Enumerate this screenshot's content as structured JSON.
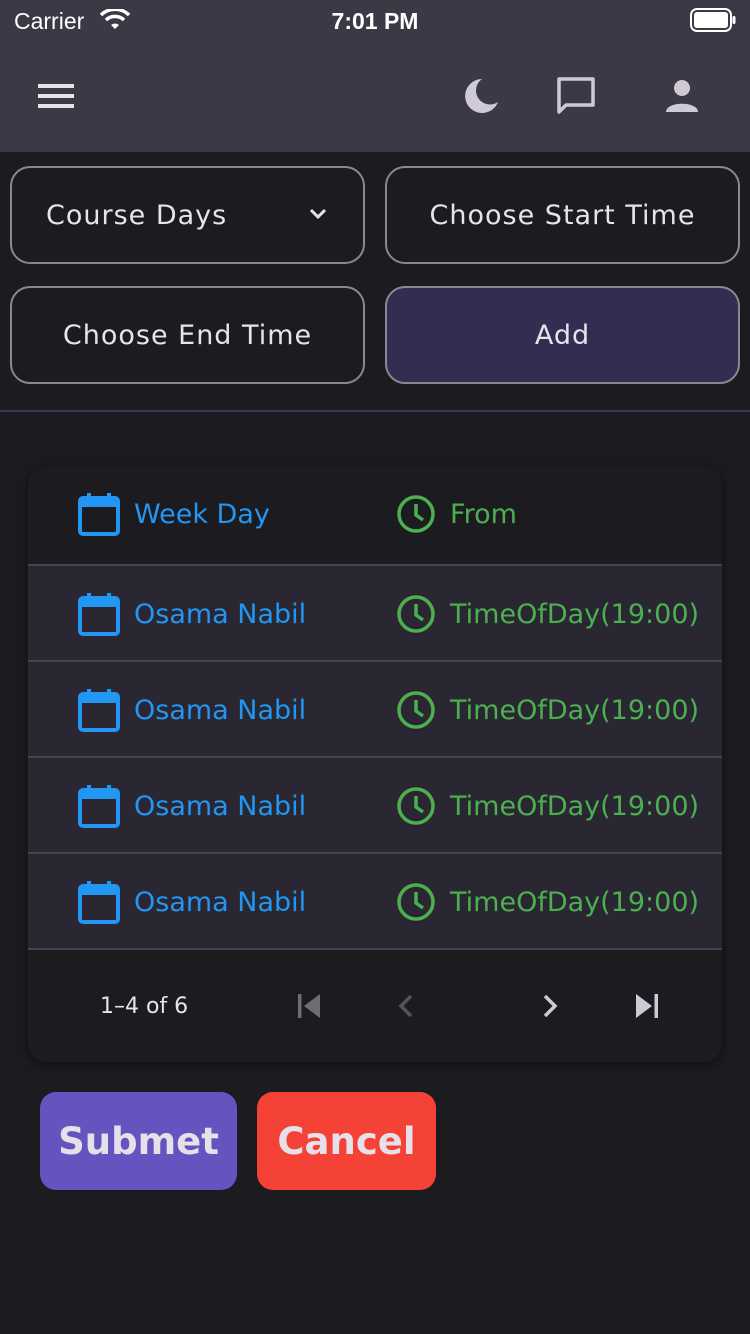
{
  "status_bar": {
    "carrier": "Carrier",
    "time": "7:01 PM"
  },
  "app_bar": {
    "icons": [
      "menu-icon",
      "moon-icon",
      "chat-icon",
      "person-icon"
    ]
  },
  "form": {
    "course_days_label": "Course Days",
    "start_time_label": "Choose Start Time",
    "end_time_label": "Choose End Time",
    "add_label": "Add"
  },
  "table": {
    "headers": {
      "day": "Week Day",
      "time": "From"
    },
    "rows": [
      {
        "day": "Osama Nabil",
        "time": "TimeOfDay(19:00)"
      },
      {
        "day": "Osama Nabil",
        "time": "TimeOfDay(19:00)"
      },
      {
        "day": "Osama Nabil",
        "time": "TimeOfDay(19:00)"
      },
      {
        "day": "Osama Nabil",
        "time": "TimeOfDay(19:00)"
      }
    ],
    "pagination": {
      "range_label": "1–4 of 6"
    }
  },
  "actions": {
    "submit_label": "Submet",
    "cancel_label": "Cancel"
  },
  "colors": {
    "app_bar": "#3b3946",
    "background": "#1c1b20",
    "day_text": "#2196f3",
    "time_text": "#4caf50",
    "submit": "#6554c0",
    "cancel": "#f44336"
  }
}
